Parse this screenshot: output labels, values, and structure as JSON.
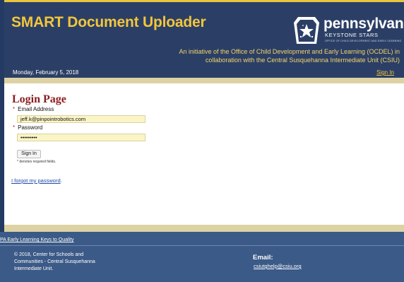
{
  "header": {
    "app_title": "SMART Document Uploader",
    "brand_name": "pennsylvania",
    "brand_sub": "KEYSTONE STARS",
    "brand_small": "OFFICE OF CHILD DEVELOPMENT AND EARLY LEARNING",
    "initiative_line1": "An initiative of the Office of Child Development and Early Learning (OCDEL) in",
    "initiative_line2": "collaboration with the Central Susquehanna Intermediate Unit (CSIU)",
    "date": "Monday, February 5, 2018",
    "signin_link": "Sign In"
  },
  "login": {
    "page_title": "Login Page",
    "required_mark": "*",
    "email_label": "Email Address",
    "email_value": "jeff.k@pinpointrobotics.com",
    "password_label": "Password",
    "password_value": "•••••••••",
    "signin_button": "Sign In",
    "required_note": "* denotes required fields.",
    "forgot_link": "I forgot my password",
    "forgot_suffix": "."
  },
  "footer": {
    "link": "PA Early Learning Keys to Quality",
    "copyright_line1": "© 2018, Center for Schools and",
    "copyright_line2": "Communities - Central Susquehanna",
    "copyright_line3": "Intermediate Unit.",
    "email_label": "Email:",
    "email_address": "csiutghelp@csiu.org"
  },
  "colors": {
    "header_bg": "#2b3f66",
    "title_gold": "#f2c63c",
    "page_title_red": "#8b1c1f",
    "field_bg": "#fbf5c6",
    "footer_bg": "#3b5a87"
  },
  "icons": {
    "logo": "keystone-star-icon"
  }
}
